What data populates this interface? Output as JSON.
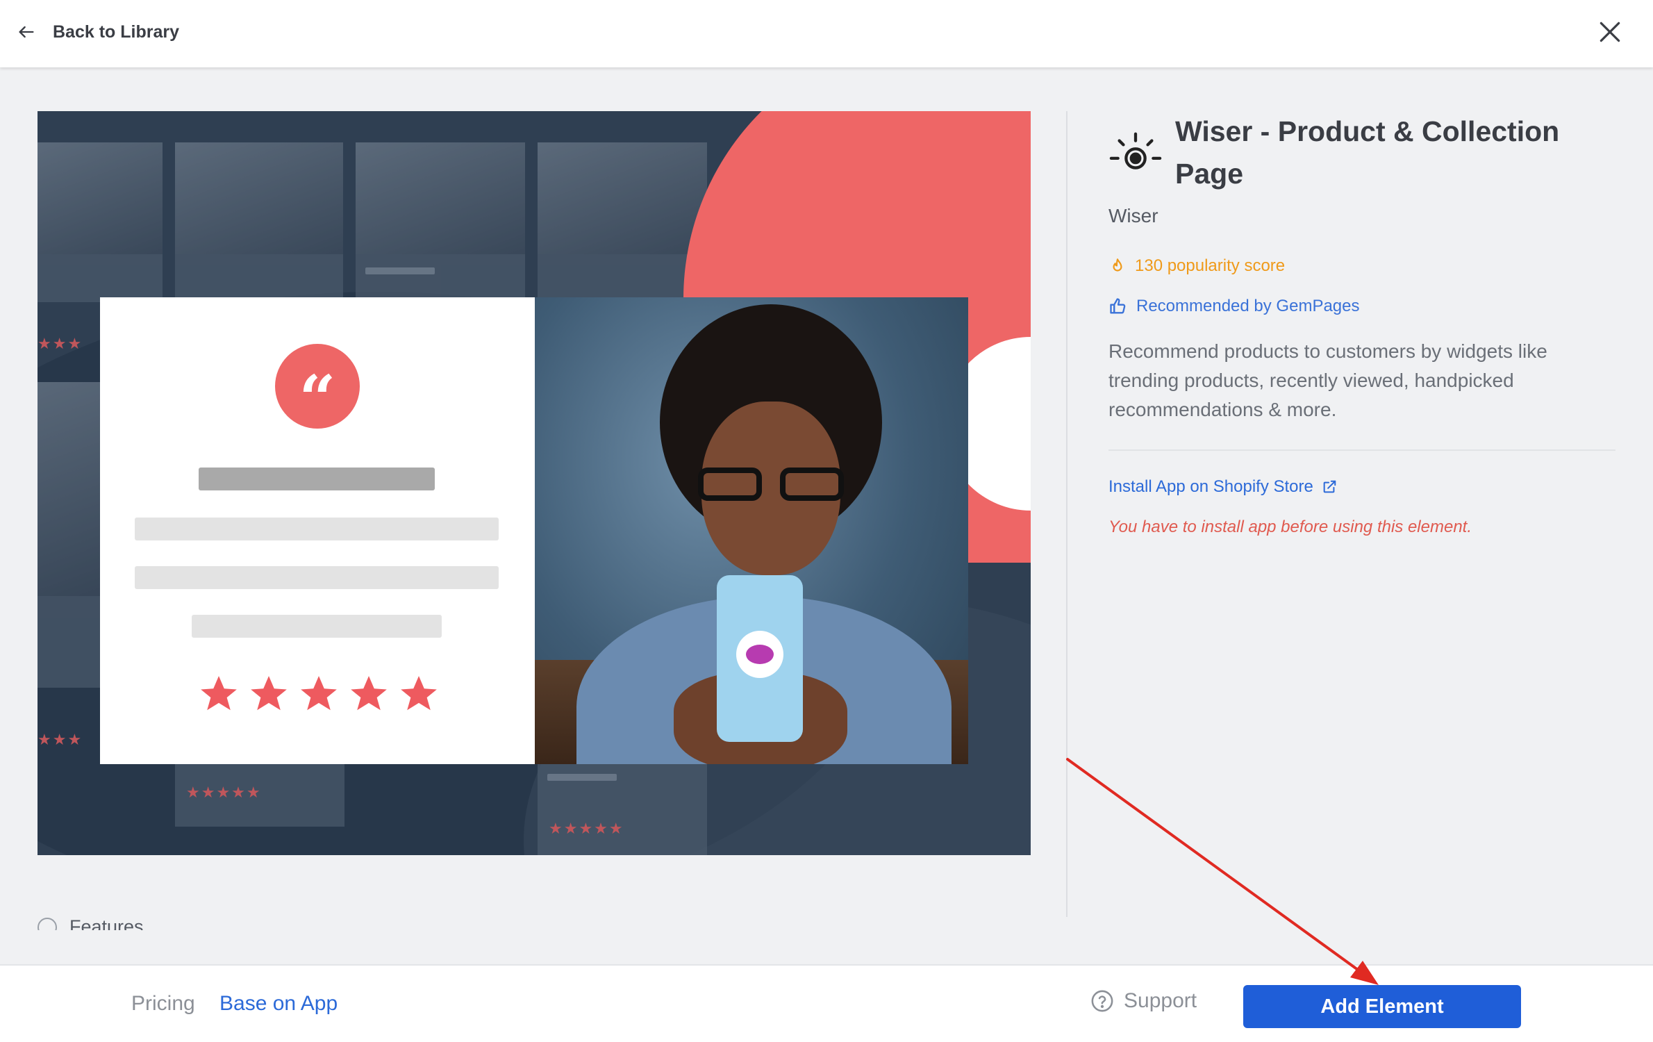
{
  "topbar": {
    "back_label": "Back to Library",
    "back_icon": "arrow-left-icon",
    "close_icon": "close-icon"
  },
  "details": {
    "app_icon": "sun-target-icon",
    "title": "Wiser - Product & Collection Page",
    "vendor": "Wiser",
    "popularity": "130 popularity score",
    "recommended": "Recommended by GemPages",
    "description": "Recommend products to customers by widgets like trending products, recently viewed, handpicked recommendations & more.",
    "install_link": "Install App on Shopify Store",
    "install_warning": "You have to install app before using this element."
  },
  "features": {
    "label": "Features"
  },
  "footer": {
    "pricing_label": "Pricing",
    "pricing_value": "Base on App",
    "support_label": "Support",
    "add_button": "Add Element"
  },
  "colors": {
    "accent_blue": "#1f5ed8",
    "link_blue": "#2c6ad8",
    "popularity_orange": "#ef9a1a",
    "warning_red": "#e05a4f",
    "hero_coral": "#ee6666",
    "annotation_red": "#e02a22"
  }
}
